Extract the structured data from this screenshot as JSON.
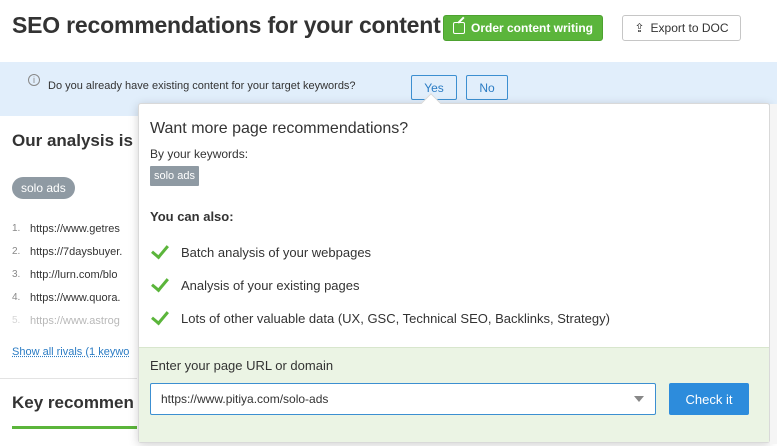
{
  "header": {
    "title": "SEO recommendations for your content",
    "order_button": "Order content writing",
    "export_button": "Export to DOC"
  },
  "banner": {
    "question": "Do you already have existing content for your target keywords?",
    "yes": "Yes",
    "no": "No"
  },
  "analysis": {
    "title": "Our analysis is b",
    "keyword": "solo ads",
    "rivals": [
      {
        "num": "1.",
        "url": "https://www.getres"
      },
      {
        "num": "2.",
        "url": "https://7daysbuyer."
      },
      {
        "num": "3.",
        "url": "http://lurn.com/blo"
      },
      {
        "num": "4.",
        "url": "https://www.quora."
      },
      {
        "num": "5.",
        "url": "https://www.astrog"
      }
    ],
    "show_rivals": "Show all rivals (1 keywo",
    "key_recs": "Key recommen"
  },
  "popover": {
    "title": "Want more page recommendations?",
    "subtitle": "By your keywords:",
    "keyword": "solo ads",
    "also_label": "You can also:",
    "features": [
      "Batch analysis of your webpages",
      "Analysis of your existing pages",
      "Lots of other valuable data (UX, GSC, Technical SEO, Backlinks, Strategy)"
    ],
    "footer_label": "Enter your page URL or domain",
    "url_value": "https://www.pitiya.com/solo-ads",
    "check_button": "Check it"
  },
  "colors": {
    "accent_green": "#5bb53b",
    "accent_blue": "#2d8cdc",
    "banner_bg": "#e1eefb",
    "footer_bg": "#ebf4e4"
  }
}
